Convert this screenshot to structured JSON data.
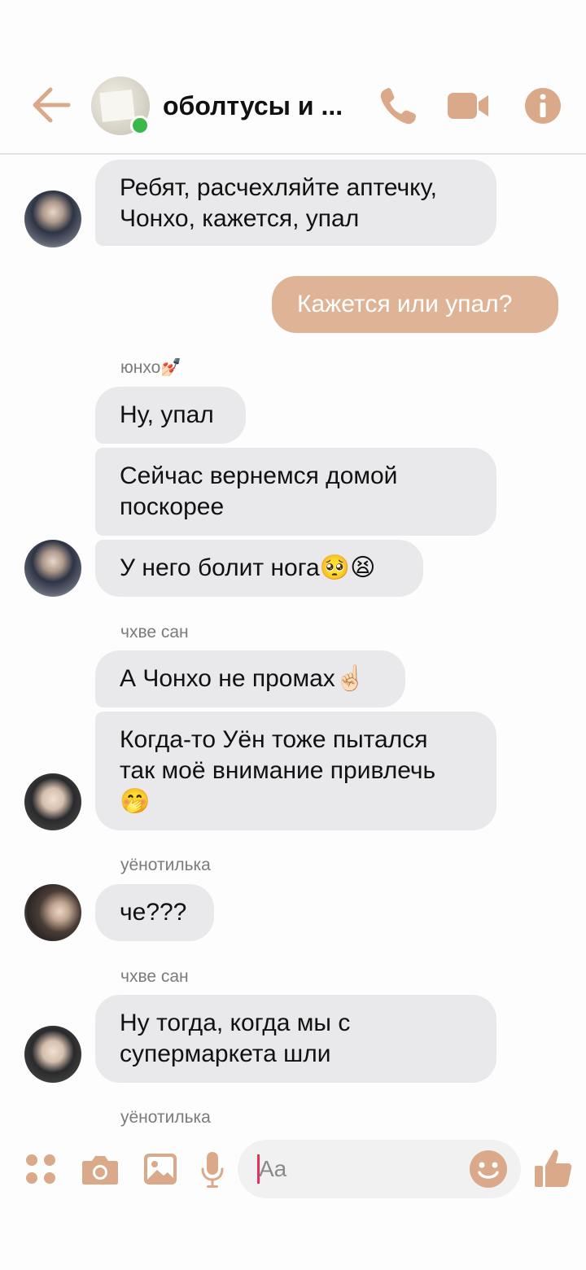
{
  "header": {
    "title": "оболтусы и ...",
    "back_icon": "arrow-left-icon",
    "call_icon": "phone-icon",
    "video_icon": "video-camera-icon",
    "info_icon": "info-icon",
    "accent": "#dfb496"
  },
  "messages": [
    {
      "type": "in",
      "text_lines": [
        "Ребят, расчехляйте аптечку,",
        "Чонхо, кажется, упал"
      ]
    },
    {
      "type": "out",
      "text": "Кажется или упал?"
    },
    {
      "type": "sender",
      "name": "юнхо💅🏻"
    },
    {
      "type": "in",
      "text": "Ну, упал"
    },
    {
      "type": "in",
      "text_lines": [
        "Сейчас вернемся домой",
        "поскорее"
      ]
    },
    {
      "type": "in",
      "text": "У него болит нога🥺😫"
    },
    {
      "type": "sender",
      "name": "чхве сан"
    },
    {
      "type": "in",
      "text": "А Чонхо не промах☝🏻"
    },
    {
      "type": "in",
      "text_lines": [
        "Когда-то Уён тоже пытался",
        "так моё внимание привлечь",
        "🤭"
      ]
    },
    {
      "type": "sender",
      "name": "уёнотилька"
    },
    {
      "type": "in",
      "text": "че???"
    },
    {
      "type": "sender",
      "name": "чхве сан"
    },
    {
      "type": "in",
      "text_lines": [
        "Ну тогда, когда мы с",
        "супермаркета шли"
      ]
    },
    {
      "type": "sender",
      "name": "уёнотилька"
    }
  ],
  "composer": {
    "placeholder": "Aa",
    "icons": [
      "apps-icon",
      "camera-icon",
      "gallery-icon",
      "microphone-icon",
      "emoji-icon",
      "thumbs-up-icon"
    ]
  },
  "colors": {
    "incoming_bubble": "#e9e8ea",
    "outgoing_bubble": "#dfb496",
    "online": "#3bb84a"
  }
}
